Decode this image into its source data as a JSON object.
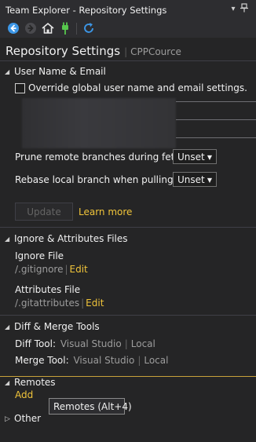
{
  "window": {
    "title": "Team Explorer - Repository Settings",
    "dropdown_icon": "dropdown-arrow-icon",
    "pin_icon": "pin-icon"
  },
  "toolbar": {
    "icons": [
      "back-icon",
      "forward-icon",
      "home-icon",
      "connect-icon",
      "refresh-icon"
    ]
  },
  "header": {
    "title": "Repository Settings",
    "separator": "|",
    "repo": "CPPCource"
  },
  "user_section": {
    "title": "User Name & Email",
    "override_label": "Override global user name and email settings.",
    "override_checked": false,
    "prune_label": "Prune remote branches during fetch:",
    "prune_value": "Unset",
    "rebase_label": "Rebase local branch when pulling:",
    "rebase_value": "Unset",
    "update_label": "Update",
    "learn_more": "Learn more"
  },
  "ignore_section": {
    "title": "Ignore & Attributes Files",
    "ignore_title": "Ignore File",
    "ignore_path": "/.gitignore",
    "ignore_edit": "Edit",
    "attr_title": "Attributes File",
    "attr_path": "/.gitattributes",
    "attr_edit": "Edit",
    "pipe": "|"
  },
  "diff_section": {
    "title": "Diff & Merge Tools",
    "diff_label": "Diff Tool:",
    "merge_label": "Merge Tool:",
    "vs": "Visual Studio",
    "local": "Local",
    "pipe": "|"
  },
  "remotes_section": {
    "title": "Remotes",
    "add": "Add",
    "tooltip": "Remotes (Alt+4)"
  },
  "other_section": {
    "title": "Other"
  },
  "colors": {
    "accent_link": "#f0c43a",
    "background": "#252526",
    "connect_icon": "#57c84d",
    "nav_icon": "#3c96e6"
  }
}
